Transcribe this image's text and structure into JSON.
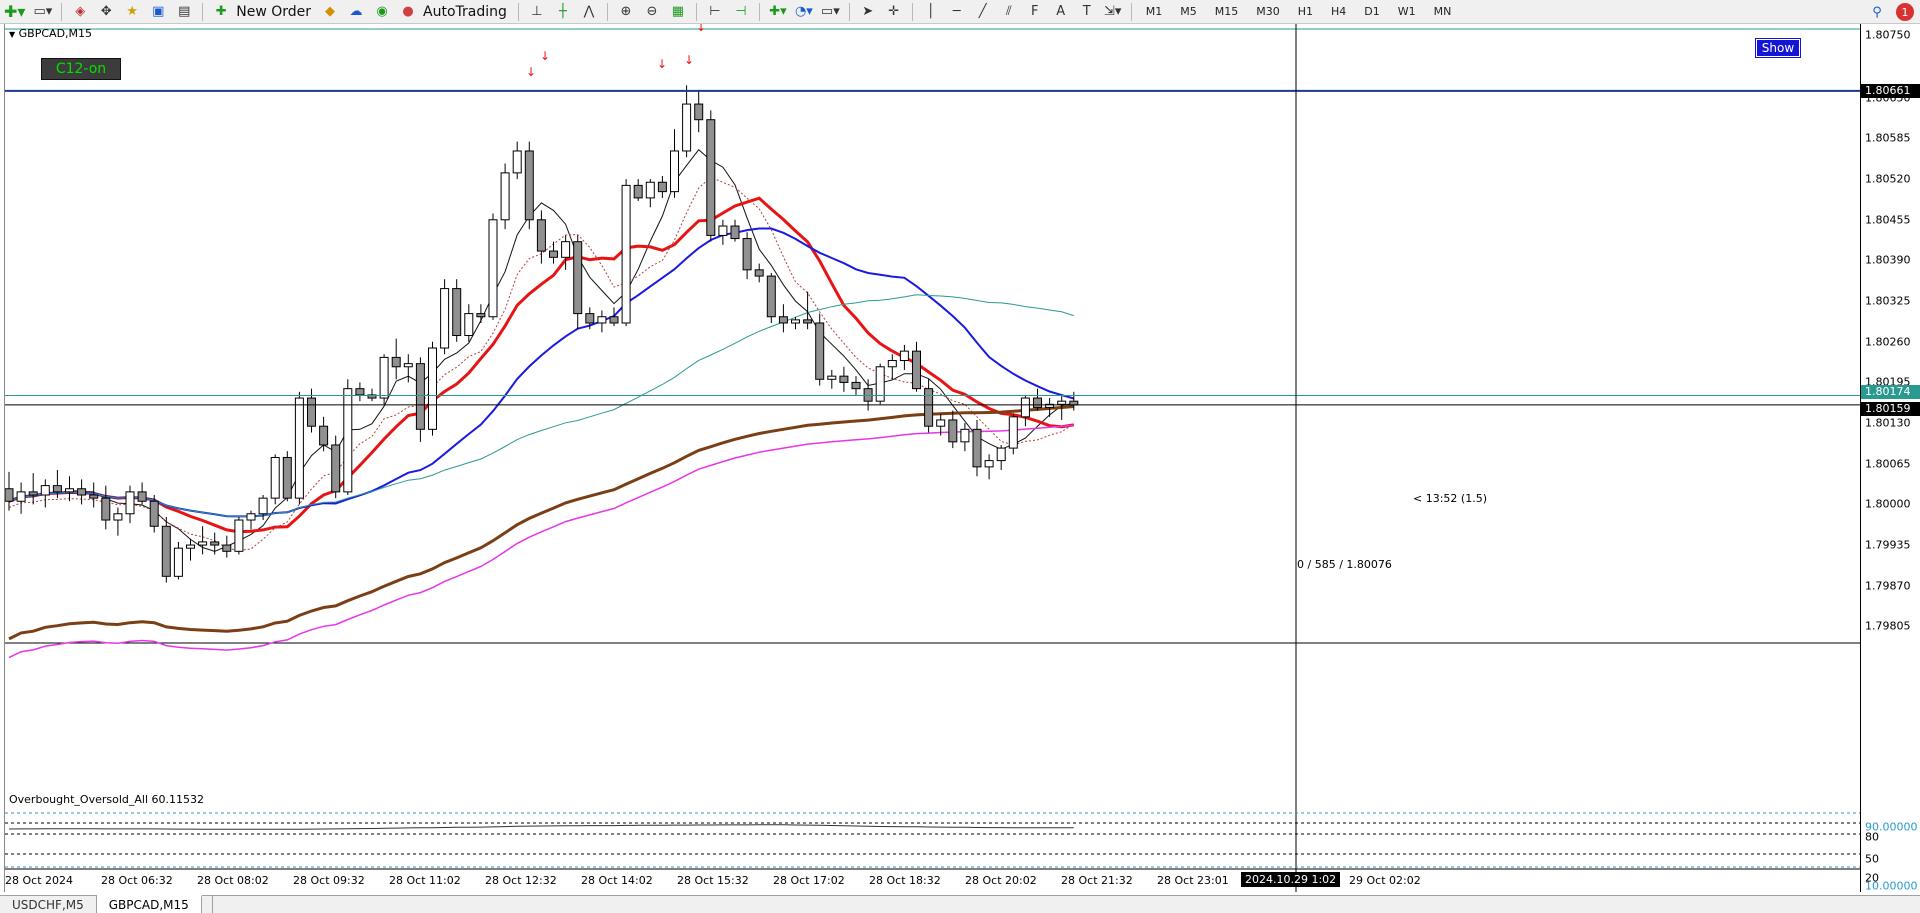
{
  "toolbar": {
    "new_order_label": "New Order",
    "autotrading_label": "AutoTrading",
    "timeframes": [
      "M1",
      "M5",
      "M15",
      "M30",
      "H1",
      "H4",
      "D1",
      "W1",
      "MN"
    ],
    "notification_count": "1"
  },
  "chart": {
    "symbol_label": "GBPCAD,M15",
    "c12_label": "C12-on",
    "show_label": "Show",
    "timer_text": "< 13:52 (1.5)",
    "cross_text": "0 / 585 / 1.80076",
    "colors": {
      "bull_body": "#ffffff",
      "bear_body": "#909090",
      "ma_red": "#e81414",
      "ma_blue": "#1a1ae0",
      "ma_brown": "#7a3f14",
      "ma_magenta": "#e636e6",
      "ma_teal": "#2a9a90"
    }
  },
  "price_axis": {
    "labels": [
      "1.80750",
      "1.80650",
      "1.80585",
      "1.80520",
      "1.80455",
      "1.80390",
      "1.80325",
      "1.80260",
      "1.80195",
      "1.80130",
      "1.80065",
      "1.80000",
      "1.79935",
      "1.79870",
      "1.79805"
    ],
    "highlight_top": "1.80661",
    "highlight_teal": "1.80174",
    "highlight_current": "1.80159"
  },
  "indicator": {
    "label": "Overbought_Oversold_All 60.11532",
    "levels": [
      "90.00000",
      "80",
      "50",
      "20",
      "10.00000"
    ]
  },
  "time_axis": {
    "labels": [
      "28 Oct 2024",
      "28 Oct 06:32",
      "28 Oct 08:02",
      "28 Oct 09:32",
      "28 Oct 11:02",
      "28 Oct 12:32",
      "28 Oct 14:02",
      "28 Oct 15:32",
      "28 Oct 17:02",
      "28 Oct 18:32",
      "28 Oct 20:02",
      "28 Oct 21:32",
      "28 Oct 23:01",
      "29 Oct 02:02"
    ],
    "crosshair_label": "2024.10.29 1:02"
  },
  "tabs": [
    "USDCHF,M5",
    "GBPCAD,M15"
  ],
  "active_tab": "GBPCAD,M15",
  "chart_data": {
    "type": "candlestick",
    "symbol": "GBPCAD",
    "timeframe": "M15",
    "ylim": [
      1.7978,
      1.80768
    ],
    "candles": [
      {
        "o": 1.80025,
        "h": 1.80052,
        "l": 1.7999,
        "c": 1.80005
      },
      {
        "o": 1.80005,
        "h": 1.80035,
        "l": 1.79985,
        "c": 1.8002
      },
      {
        "o": 1.8002,
        "h": 1.8005,
        "l": 1.8,
        "c": 1.80015
      },
      {
        "o": 1.80015,
        "h": 1.8004,
        "l": 1.79995,
        "c": 1.8003
      },
      {
        "o": 1.8003,
        "h": 1.80055,
        "l": 1.8001,
        "c": 1.8002
      },
      {
        "o": 1.8002,
        "h": 1.80045,
        "l": 1.80005,
        "c": 1.80025
      },
      {
        "o": 1.80025,
        "h": 1.8004,
        "l": 1.8,
        "c": 1.80015
      },
      {
        "o": 1.80015,
        "h": 1.80035,
        "l": 1.79995,
        "c": 1.8001
      },
      {
        "o": 1.8001,
        "h": 1.8003,
        "l": 1.7996,
        "c": 1.79975
      },
      {
        "o": 1.79975,
        "h": 1.79995,
        "l": 1.7995,
        "c": 1.79985
      },
      {
        "o": 1.79985,
        "h": 1.8003,
        "l": 1.7997,
        "c": 1.8002
      },
      {
        "o": 1.8002,
        "h": 1.80035,
        "l": 1.8,
        "c": 1.80005
      },
      {
        "o": 1.80005,
        "h": 1.80015,
        "l": 1.79955,
        "c": 1.79965
      },
      {
        "o": 1.79965,
        "h": 1.7998,
        "l": 1.79875,
        "c": 1.79885
      },
      {
        "o": 1.79885,
        "h": 1.7994,
        "l": 1.7988,
        "c": 1.7993
      },
      {
        "o": 1.7993,
        "h": 1.79945,
        "l": 1.7991,
        "c": 1.79935
      },
      {
        "o": 1.79935,
        "h": 1.79965,
        "l": 1.7992,
        "c": 1.7994
      },
      {
        "o": 1.7994,
        "h": 1.79955,
        "l": 1.7992,
        "c": 1.79935
      },
      {
        "o": 1.79935,
        "h": 1.7995,
        "l": 1.79915,
        "c": 1.79925
      },
      {
        "o": 1.79925,
        "h": 1.7998,
        "l": 1.7992,
        "c": 1.79975
      },
      {
        "o": 1.79975,
        "h": 1.7999,
        "l": 1.7996,
        "c": 1.79985
      },
      {
        "o": 1.79985,
        "h": 1.80015,
        "l": 1.79975,
        "c": 1.8001
      },
      {
        "o": 1.8001,
        "h": 1.8008,
        "l": 1.8,
        "c": 1.80075
      },
      {
        "o": 1.80075,
        "h": 1.80085,
        "l": 1.80005,
        "c": 1.8001
      },
      {
        "o": 1.8001,
        "h": 1.8018,
        "l": 1.8,
        "c": 1.8017
      },
      {
        "o": 1.8017,
        "h": 1.80185,
        "l": 1.80115,
        "c": 1.80125
      },
      {
        "o": 1.80125,
        "h": 1.8014,
        "l": 1.80085,
        "c": 1.80095
      },
      {
        "o": 1.80095,
        "h": 1.8011,
        "l": 1.8001,
        "c": 1.8002
      },
      {
        "o": 1.8002,
        "h": 1.802,
        "l": 1.80015,
        "c": 1.80185
      },
      {
        "o": 1.80185,
        "h": 1.80195,
        "l": 1.80165,
        "c": 1.80175
      },
      {
        "o": 1.80175,
        "h": 1.80185,
        "l": 1.80165,
        "c": 1.8017
      },
      {
        "o": 1.8017,
        "h": 1.8024,
        "l": 1.8016,
        "c": 1.80235
      },
      {
        "o": 1.80235,
        "h": 1.80265,
        "l": 1.802,
        "c": 1.8022
      },
      {
        "o": 1.8022,
        "h": 1.8024,
        "l": 1.80195,
        "c": 1.80225
      },
      {
        "o": 1.80225,
        "h": 1.80235,
        "l": 1.801,
        "c": 1.8012
      },
      {
        "o": 1.8012,
        "h": 1.8026,
        "l": 1.8011,
        "c": 1.8025
      },
      {
        "o": 1.8025,
        "h": 1.8036,
        "l": 1.8024,
        "c": 1.80345
      },
      {
        "o": 1.80345,
        "h": 1.8036,
        "l": 1.8026,
        "c": 1.8027
      },
      {
        "o": 1.8027,
        "h": 1.8032,
        "l": 1.8026,
        "c": 1.80305
      },
      {
        "o": 1.80305,
        "h": 1.8032,
        "l": 1.8029,
        "c": 1.803
      },
      {
        "o": 1.803,
        "h": 1.80465,
        "l": 1.80295,
        "c": 1.80455
      },
      {
        "o": 1.80455,
        "h": 1.80545,
        "l": 1.8044,
        "c": 1.8053
      },
      {
        "o": 1.8053,
        "h": 1.8058,
        "l": 1.8052,
        "c": 1.80565
      },
      {
        "o": 1.80565,
        "h": 1.8058,
        "l": 1.8044,
        "c": 1.80455
      },
      {
        "o": 1.80455,
        "h": 1.8047,
        "l": 1.80385,
        "c": 1.80405
      },
      {
        "o": 1.80405,
        "h": 1.8042,
        "l": 1.80385,
        "c": 1.80395
      },
      {
        "o": 1.80395,
        "h": 1.8043,
        "l": 1.80375,
        "c": 1.8042
      },
      {
        "o": 1.8042,
        "h": 1.8043,
        "l": 1.8028,
        "c": 1.80305
      },
      {
        "o": 1.80305,
        "h": 1.80315,
        "l": 1.8028,
        "c": 1.8029
      },
      {
        "o": 1.8029,
        "h": 1.8031,
        "l": 1.80275,
        "c": 1.803
      },
      {
        "o": 1.803,
        "h": 1.80315,
        "l": 1.80285,
        "c": 1.8029
      },
      {
        "o": 1.8029,
        "h": 1.8052,
        "l": 1.80285,
        "c": 1.8051
      },
      {
        "o": 1.8051,
        "h": 1.8052,
        "l": 1.80485,
        "c": 1.8049
      },
      {
        "o": 1.8049,
        "h": 1.8052,
        "l": 1.80475,
        "c": 1.80515
      },
      {
        "o": 1.80515,
        "h": 1.80525,
        "l": 1.8049,
        "c": 1.805
      },
      {
        "o": 1.805,
        "h": 1.806,
        "l": 1.8049,
        "c": 1.80565
      },
      {
        "o": 1.80565,
        "h": 1.8067,
        "l": 1.80555,
        "c": 1.8064
      },
      {
        "o": 1.8064,
        "h": 1.80661,
        "l": 1.80595,
        "c": 1.80615
      },
      {
        "o": 1.80615,
        "h": 1.8063,
        "l": 1.8042,
        "c": 1.8043
      },
      {
        "o": 1.8043,
        "h": 1.80455,
        "l": 1.80415,
        "c": 1.80445
      },
      {
        "o": 1.80445,
        "h": 1.80455,
        "l": 1.8042,
        "c": 1.80425
      },
      {
        "o": 1.80425,
        "h": 1.80435,
        "l": 1.8036,
        "c": 1.80375
      },
      {
        "o": 1.80375,
        "h": 1.80385,
        "l": 1.80355,
        "c": 1.80365
      },
      {
        "o": 1.80365,
        "h": 1.8037,
        "l": 1.8029,
        "c": 1.803
      },
      {
        "o": 1.803,
        "h": 1.8032,
        "l": 1.80275,
        "c": 1.8029
      },
      {
        "o": 1.8029,
        "h": 1.803,
        "l": 1.8028,
        "c": 1.80295
      },
      {
        "o": 1.80295,
        "h": 1.8034,
        "l": 1.8028,
        "c": 1.8029
      },
      {
        "o": 1.8029,
        "h": 1.80305,
        "l": 1.8019,
        "c": 1.802
      },
      {
        "o": 1.802,
        "h": 1.80215,
        "l": 1.80185,
        "c": 1.80205
      },
      {
        "o": 1.80205,
        "h": 1.8022,
        "l": 1.8018,
        "c": 1.80195
      },
      {
        "o": 1.80195,
        "h": 1.80205,
        "l": 1.80175,
        "c": 1.80185
      },
      {
        "o": 1.80185,
        "h": 1.802,
        "l": 1.8015,
        "c": 1.80165
      },
      {
        "o": 1.80165,
        "h": 1.80225,
        "l": 1.8016,
        "c": 1.8022
      },
      {
        "o": 1.8022,
        "h": 1.8024,
        "l": 1.802,
        "c": 1.8023
      },
      {
        "o": 1.8023,
        "h": 1.80255,
        "l": 1.80215,
        "c": 1.80245
      },
      {
        "o": 1.80245,
        "h": 1.8026,
        "l": 1.8018,
        "c": 1.80185
      },
      {
        "o": 1.80185,
        "h": 1.802,
        "l": 1.80115,
        "c": 1.80125
      },
      {
        "o": 1.80125,
        "h": 1.80145,
        "l": 1.8011,
        "c": 1.80135
      },
      {
        "o": 1.80135,
        "h": 1.8015,
        "l": 1.8009,
        "c": 1.801
      },
      {
        "o": 1.801,
        "h": 1.8013,
        "l": 1.80085,
        "c": 1.8012
      },
      {
        "o": 1.8012,
        "h": 1.80135,
        "l": 1.80045,
        "c": 1.8006
      },
      {
        "o": 1.8006,
        "h": 1.8008,
        "l": 1.8004,
        "c": 1.8007
      },
      {
        "o": 1.8007,
        "h": 1.80095,
        "l": 1.80055,
        "c": 1.8009
      },
      {
        "o": 1.8009,
        "h": 1.80145,
        "l": 1.8008,
        "c": 1.8014
      },
      {
        "o": 1.8014,
        "h": 1.80175,
        "l": 1.80125,
        "c": 1.8017
      },
      {
        "o": 1.8017,
        "h": 1.80185,
        "l": 1.8015,
        "c": 1.80155
      },
      {
        "o": 1.80155,
        "h": 1.8017,
        "l": 1.8014,
        "c": 1.8016
      },
      {
        "o": 1.8016,
        "h": 1.80175,
        "l": 1.80135,
        "c": 1.80165
      },
      {
        "o": 1.80165,
        "h": 1.8018,
        "l": 1.8015,
        "c": 1.80159
      }
    ],
    "horizontal_lines": [
      1.80661,
      1.80174,
      1.80159
    ]
  }
}
